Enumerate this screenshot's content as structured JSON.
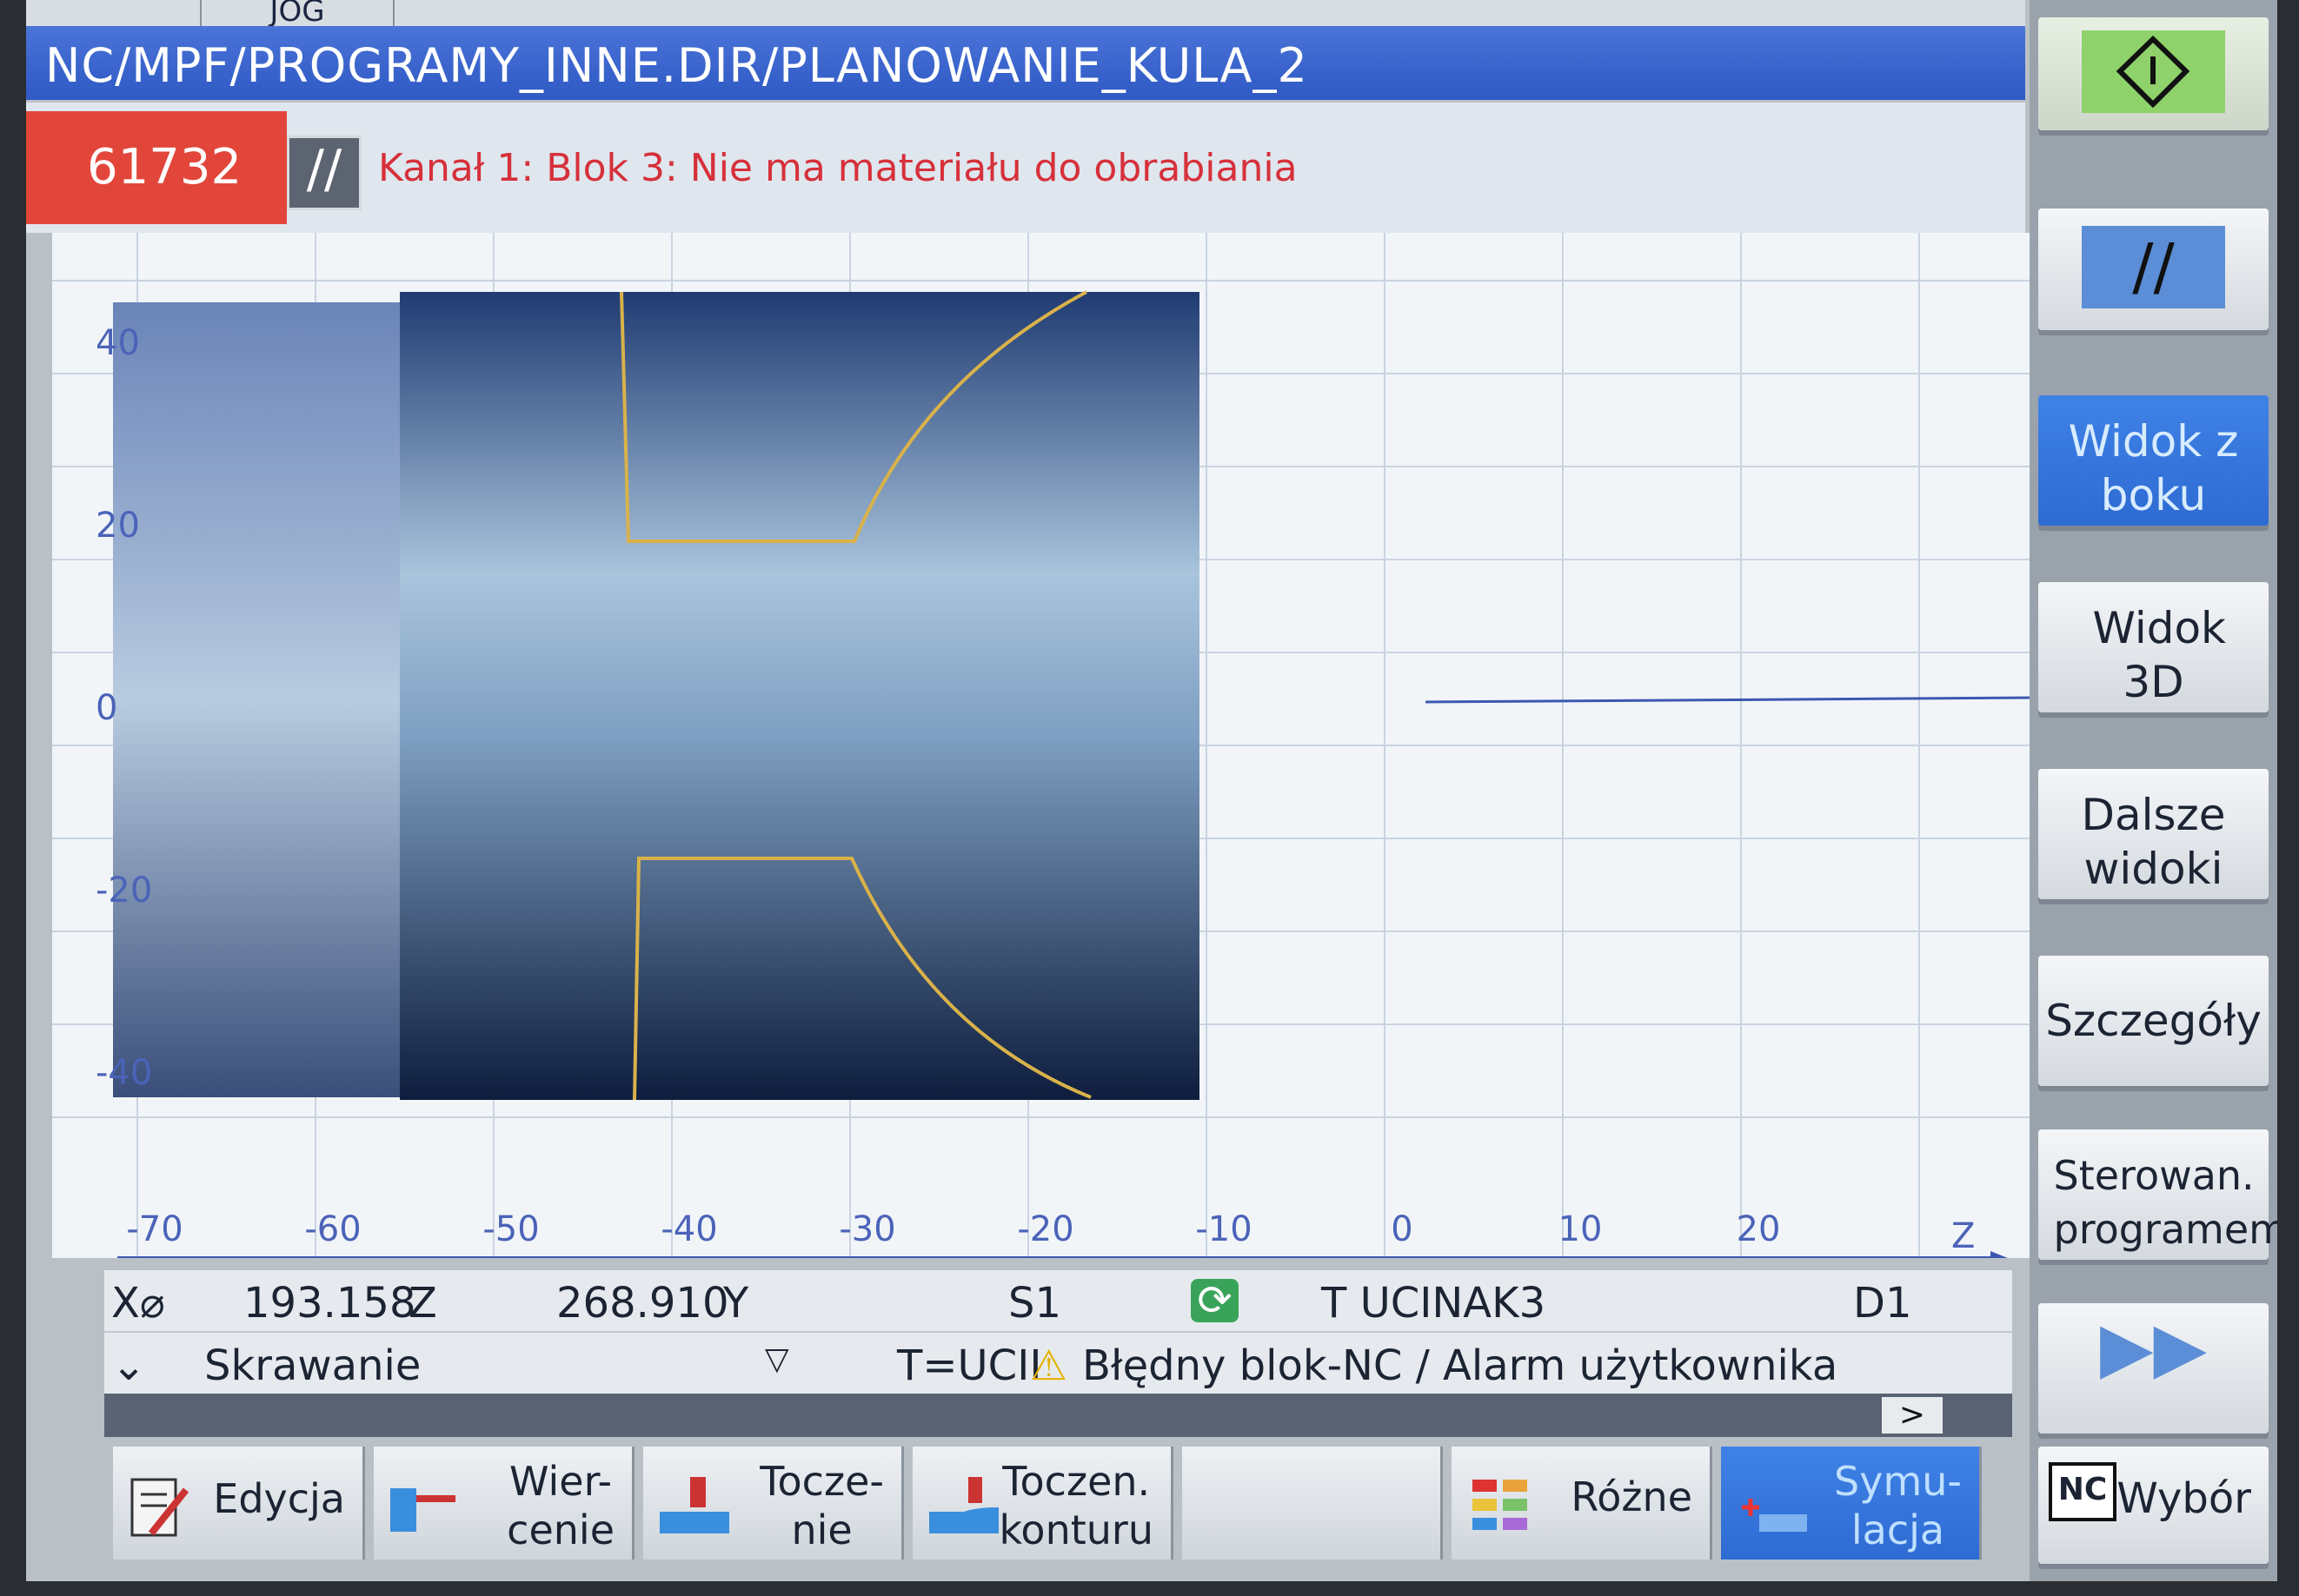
{
  "header": {
    "mode": "JOG",
    "path": "NC/MPF/PROGRAMY_INNE.DIR/PLANOWANIE_KULA_2"
  },
  "alarm": {
    "number": "61732",
    "message": "Kanał 1: Blok 3: Nie ma  materiału do obrabiania",
    "color": "#e2463a"
  },
  "plot": {
    "x_ticks": [
      "-70",
      "-60",
      "-50",
      "-40",
      "-30",
      "-20",
      "-10",
      "0",
      "10",
      "20"
    ],
    "y_ticks": [
      "40",
      "20",
      "0",
      "-20",
      "-40"
    ],
    "axis_label": "Z",
    "contour_color": "#d9b24a"
  },
  "status": {
    "x_label": "X⌀",
    "x_value": "193.158",
    "z_label": "Z",
    "z_value": "268.910",
    "y_label": "Y",
    "spindle": "S1",
    "tool": "T UCINAK3",
    "d_number": "D1",
    "operation": "Skrawanie",
    "tool_short": "T=UCII",
    "alarm_text": "Błędny blok-NC / Alarm użytkownika",
    "more": ">"
  },
  "softkeys_right": {
    "start_icon": "cycle-start-icon",
    "reset_icon": "reset-icon",
    "side_view": "Widok z boku",
    "view_3d": "Widok 3D",
    "more_views": "Dalsze widoki",
    "details": "Szczegóły",
    "program_control": "Sterowan. programem",
    "forward_icon": "fast-forward-icon"
  },
  "softkeys_bottom": {
    "edit": "Edycja",
    "drilling": "Wier-\ncenie",
    "turning": "Tocze-\nnie",
    "contour_turning": "Toczen.\nkonturu",
    "misc": "Różne",
    "simulation": "Symu-\nlacja",
    "select": "Wybór",
    "nc_label": "NC"
  },
  "colors": {
    "title_bar": "#2f59c4",
    "active_key": "#2e6bd3",
    "start_key": "#8fd16a"
  }
}
